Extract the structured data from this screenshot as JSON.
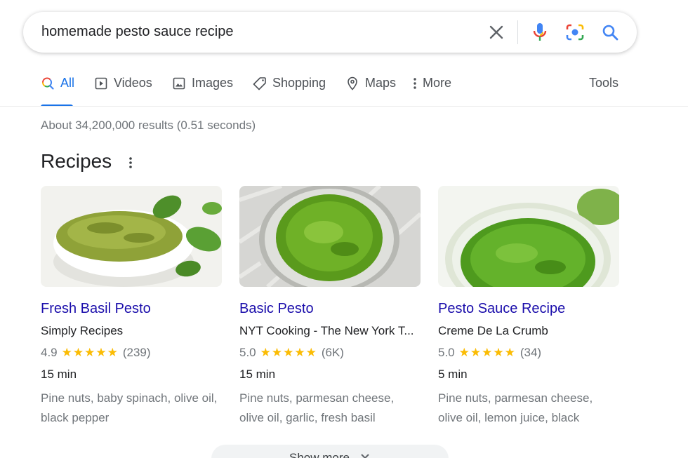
{
  "search": {
    "query": "homemade pesto sauce recipe"
  },
  "tabs": [
    {
      "label": "All",
      "icon": "search-icon"
    },
    {
      "label": "Videos",
      "icon": "video-icon"
    },
    {
      "label": "Images",
      "icon": "image-icon"
    },
    {
      "label": "Shopping",
      "icon": "tag-icon"
    },
    {
      "label": "Maps",
      "icon": "map-pin-icon"
    },
    {
      "label": "More",
      "icon": "kebab-icon"
    }
  ],
  "tools_label": "Tools",
  "result_stats": "About 34,200,000 results (0.51 seconds)",
  "section_title": "Recipes",
  "recipes": [
    {
      "title": "Fresh Basil Pesto",
      "source": "Simply Recipes",
      "rating": "4.9",
      "stars": "★★★★★",
      "reviews": "(239)",
      "time": "15 min",
      "ingredients": "Pine nuts, baby spinach, olive oil, black pepper"
    },
    {
      "title": "Basic Pesto",
      "source": "NYT Cooking - The New York T...",
      "rating": "5.0",
      "stars": "★★★★★",
      "reviews": "(6K)",
      "time": "15 min",
      "ingredients": "Pine nuts, parmesan cheese, olive oil, garlic, fresh basil"
    },
    {
      "title": "Pesto Sauce Recipe",
      "source": "Creme De La Crumb",
      "rating": "5.0",
      "stars": "★★★★★",
      "reviews": "(34)",
      "time": "5 min",
      "ingredients": "Pine nuts, parmesan cheese, olive oil, lemon juice, black"
    }
  ],
  "show_more_label": "Show more",
  "colors": {
    "link": "#1a0dab",
    "accent": "#1a73e8",
    "star": "#fbbc04"
  }
}
